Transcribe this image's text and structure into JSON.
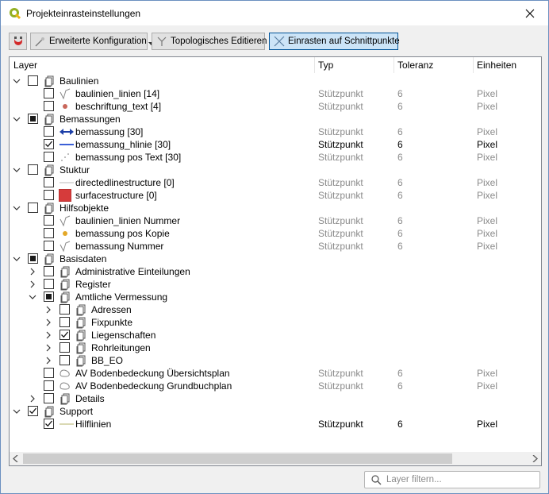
{
  "window": {
    "title": "Projekteinrasteinstellungen"
  },
  "toolbar": {
    "advanced_label": "Erweiterte Konfiguration",
    "topo_label": "Topologisches Editieren",
    "intersection_label": "Einrasten auf Schnittpunkte"
  },
  "columns": {
    "layer": "Layer",
    "type": "Typ",
    "tolerance": "Toleranz",
    "units": "Einheiten"
  },
  "filter": {
    "placeholder": "Layer filtern..."
  },
  "colors": {
    "accent": "#cce4f7",
    "dim_text": "#8a8a8a",
    "window_border": "#6b8fc0"
  },
  "rows": [
    {
      "level": 0,
      "arrow": "down",
      "check": "none",
      "icon": "group-icon",
      "name": "Baulinien"
    },
    {
      "level": 1,
      "arrow": "",
      "check": "none",
      "icon": "line-layer-icon",
      "name": "baulinien_linien [14]",
      "type": "Stützpunkt",
      "tol": "6",
      "unit": "Pixel",
      "active": false
    },
    {
      "level": 1,
      "arrow": "",
      "check": "none",
      "icon": "point-layer-icon",
      "name": "beschriftung_text [4]",
      "type": "Stützpunkt",
      "tol": "6",
      "unit": "Pixel",
      "active": false
    },
    {
      "level": 0,
      "arrow": "down",
      "check": "partial",
      "icon": "group-icon",
      "name": "Bemassungen"
    },
    {
      "level": 1,
      "arrow": "",
      "check": "none",
      "icon": "arrow-line-icon",
      "name": "bemassung [30]",
      "type": "Stützpunkt",
      "tol": "6",
      "unit": "Pixel",
      "active": false
    },
    {
      "level": 1,
      "arrow": "",
      "check": "checked",
      "icon": "blue-line-icon",
      "name": "bemassung_hlinie [30]",
      "type": "Stützpunkt",
      "tol": "6",
      "unit": "Pixel",
      "active": true
    },
    {
      "level": 1,
      "arrow": "",
      "check": "none",
      "icon": "scatter-point-icon",
      "name": "bemassung pos Text [30]",
      "type": "Stützpunkt",
      "tol": "6",
      "unit": "Pixel",
      "active": false
    },
    {
      "level": 0,
      "arrow": "down",
      "check": "none",
      "icon": "group-icon",
      "name": "Stuktur"
    },
    {
      "level": 1,
      "arrow": "",
      "check": "none",
      "icon": "grey-line-icon",
      "name": "directedlinestructure [0]",
      "type": "Stützpunkt",
      "tol": "6",
      "unit": "Pixel",
      "active": false
    },
    {
      "level": 1,
      "arrow": "",
      "check": "none",
      "icon": "red-polygon-icon",
      "name": "surfacestructure [0]",
      "type": "Stützpunkt",
      "tol": "6",
      "unit": "Pixel",
      "active": false
    },
    {
      "level": 0,
      "arrow": "down",
      "check": "none",
      "icon": "group-icon",
      "name": "Hilfsobjekte"
    },
    {
      "level": 1,
      "arrow": "",
      "check": "none",
      "icon": "line-layer-icon",
      "name": "baulinien_linien Nummer",
      "type": "Stützpunkt",
      "tol": "6",
      "unit": "Pixel",
      "active": false
    },
    {
      "level": 1,
      "arrow": "",
      "check": "none",
      "icon": "yellow-point-icon",
      "name": "bemassung pos Kopie",
      "type": "Stützpunkt",
      "tol": "6",
      "unit": "Pixel",
      "active": false
    },
    {
      "level": 1,
      "arrow": "",
      "check": "none",
      "icon": "line-layer-icon",
      "name": "bemassung Nummer",
      "type": "Stützpunkt",
      "tol": "6",
      "unit": "Pixel",
      "active": false
    },
    {
      "level": 0,
      "arrow": "down",
      "check": "partial",
      "icon": "group-icon",
      "name": "Basisdaten"
    },
    {
      "level": 1,
      "arrow": "right",
      "check": "none",
      "icon": "group-icon",
      "name": "Administrative Einteilungen"
    },
    {
      "level": 1,
      "arrow": "right",
      "check": "none",
      "icon": "group-icon",
      "name": "Register"
    },
    {
      "level": 1,
      "arrow": "down",
      "check": "partial",
      "icon": "group-icon",
      "name": "Amtliche Vermessung"
    },
    {
      "level": 2,
      "arrow": "right",
      "check": "none",
      "icon": "group-icon",
      "name": "Adressen"
    },
    {
      "level": 2,
      "arrow": "right",
      "check": "none",
      "icon": "group-icon",
      "name": "Fixpunkte"
    },
    {
      "level": 2,
      "arrow": "right",
      "check": "checked",
      "icon": "group-icon",
      "name": "Liegenschaften"
    },
    {
      "level": 2,
      "arrow": "right",
      "check": "none",
      "icon": "group-icon",
      "name": "Rohrleitungen"
    },
    {
      "level": 2,
      "arrow": "right",
      "check": "none",
      "icon": "group-icon",
      "name": "BB_EO"
    },
    {
      "level": 1,
      "arrow": "",
      "check": "none",
      "icon": "wms-layer-icon",
      "name": "AV Bodenbedeckung Übersichtsplan",
      "type": "Stützpunkt",
      "tol": "6",
      "unit": "Pixel",
      "active": false
    },
    {
      "level": 1,
      "arrow": "",
      "check": "none",
      "icon": "wms-layer-icon",
      "name": "AV Bodenbedeckung Grundbuchplan",
      "type": "Stützpunkt",
      "tol": "6",
      "unit": "Pixel",
      "active": false
    },
    {
      "level": 1,
      "arrow": "right",
      "check": "none",
      "icon": "group-icon",
      "name": "Details"
    },
    {
      "level": 0,
      "arrow": "down",
      "check": "checked",
      "icon": "group-icon",
      "name": "Support"
    },
    {
      "level": 1,
      "arrow": "",
      "check": "checked",
      "icon": "olive-line-icon",
      "name": "Hilflinien",
      "type": "Stützpunkt",
      "tol": "6",
      "unit": "Pixel",
      "active": true
    }
  ]
}
